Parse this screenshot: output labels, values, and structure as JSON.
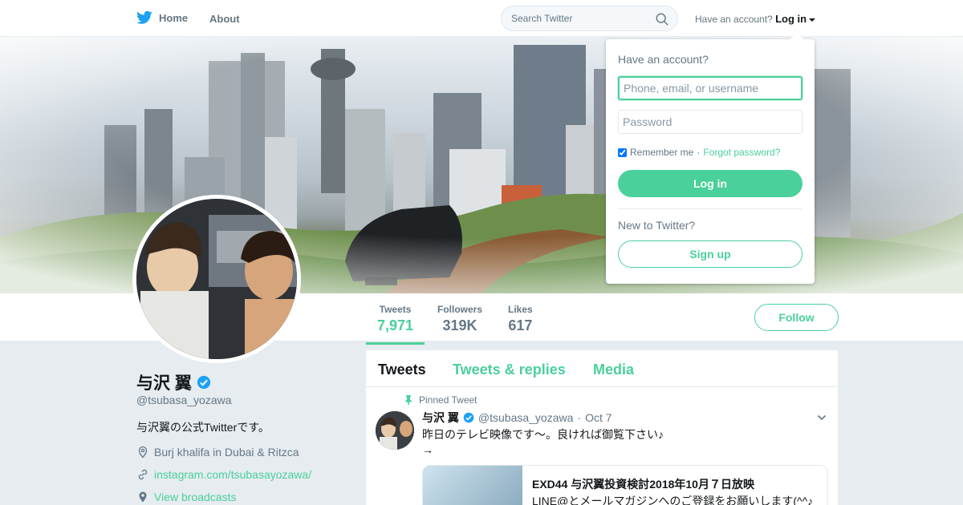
{
  "nav": {
    "home_label": "Home",
    "about_label": "About",
    "search_placeholder": "Search Twitter",
    "account_prompt": "Have an account?",
    "login_label": "Log in"
  },
  "profile": {
    "name": "与沢 翼",
    "handle": "@tsubasa_yozawa",
    "bio": "与沢翼の公式Twitterです。",
    "location": "Burj khalifa in Dubai & Ritzca",
    "website": "instagram.com/tsubasayozawa/",
    "broadcasts": "View broadcasts"
  },
  "stats": [
    {
      "label": "Tweets",
      "value": "7,971"
    },
    {
      "label": "Followers",
      "value": "319K"
    },
    {
      "label": "Likes",
      "value": "617"
    }
  ],
  "follow_label": "Follow",
  "timeline": {
    "tabs": [
      "Tweets",
      "Tweets & replies",
      "Media"
    ],
    "pinned_label": "Pinned Tweet",
    "tweet": {
      "name": "与沢 翼",
      "handle": "@tsubasa_yozawa",
      "date": "Oct 7",
      "separator": "·",
      "text": "昨日のテレビ映像です～。良ければ御覧下さい♪",
      "text_line2": "→",
      "card_title": "EXD44 与沢翼投資検討2018年10月７日放映",
      "card_desc": "LINE@とメールマガジンへのご登録をお願いします(^^♪"
    }
  },
  "login_dropdown": {
    "title": "Have an account?",
    "username_placeholder": "Phone, email, or username",
    "password_placeholder": "Password",
    "remember_label": "Remember me",
    "separator": "·",
    "forgot_label": "Forgot password?",
    "login_button": "Log in",
    "new_label": "New to Twitter?",
    "signup_button": "Sign up"
  },
  "colors": {
    "accent": "#4ad09a",
    "twitter_blue": "#1da1f2",
    "muted": "#657786"
  }
}
